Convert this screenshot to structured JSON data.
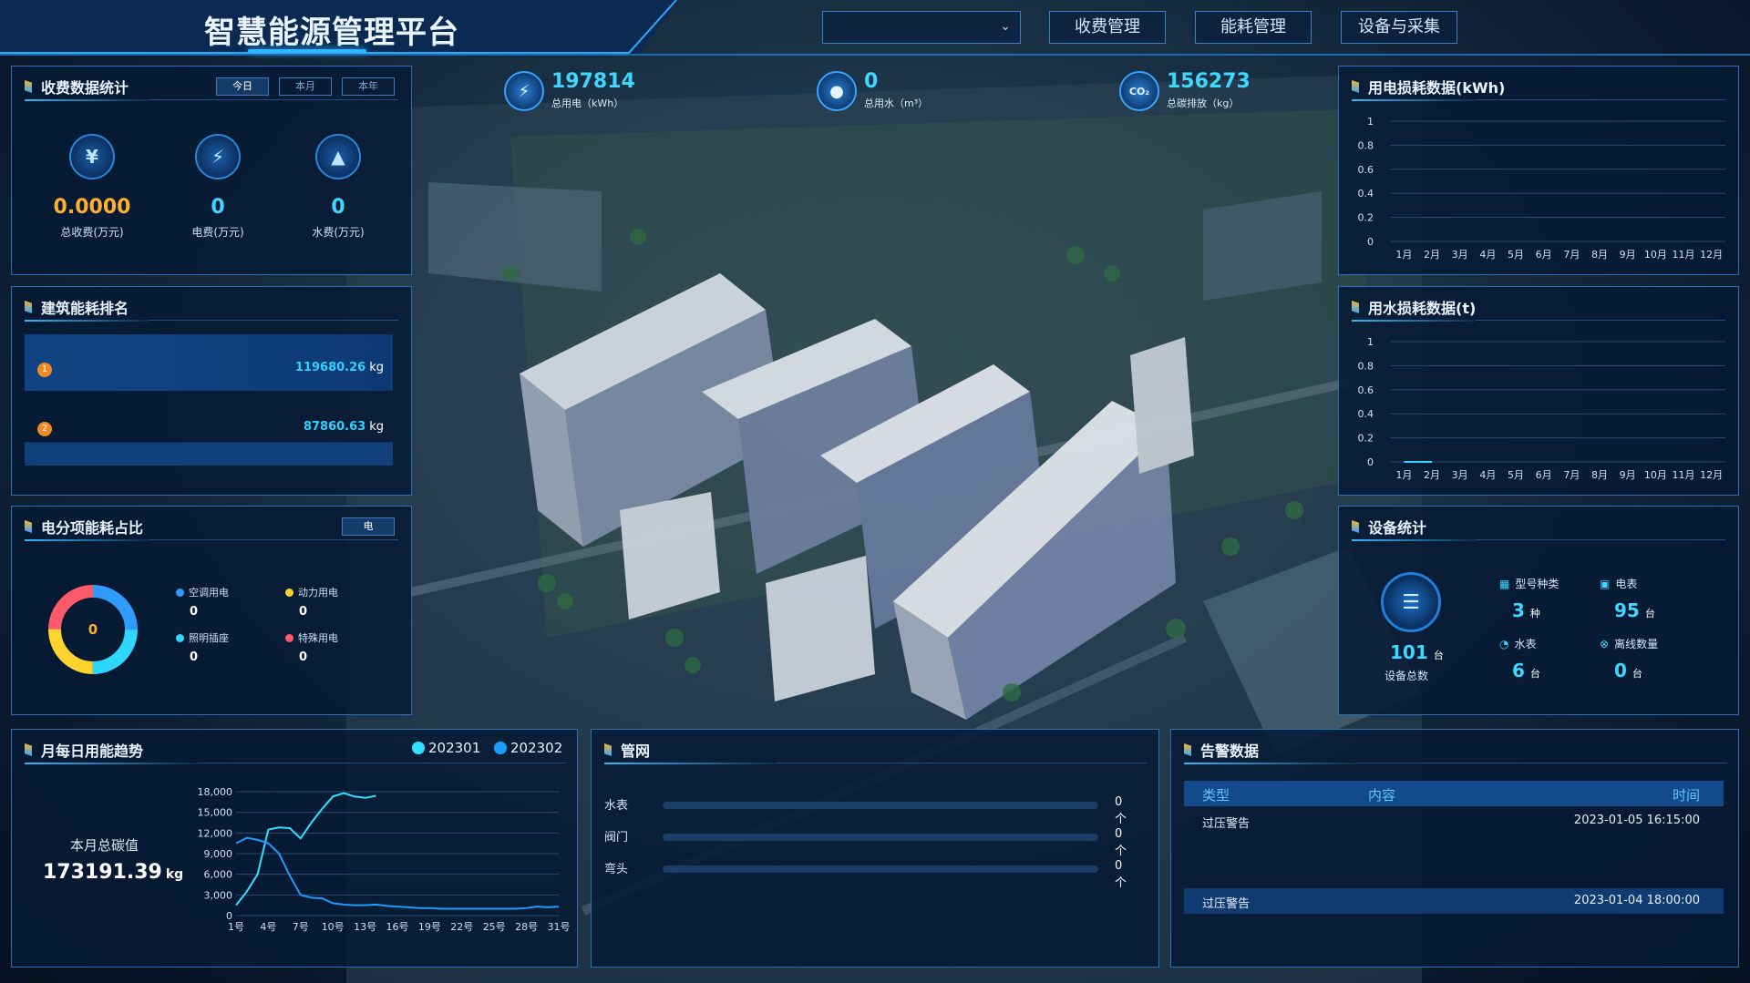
{
  "header": {
    "title": "智慧能源管理平台",
    "select_value": "",
    "nav": [
      "收费管理",
      "能耗管理",
      "设备与采集"
    ]
  },
  "kpis": [
    {
      "icon": "lightning-icon",
      "value": "197814",
      "label": "总用电（kWh）"
    },
    {
      "icon": "water-drop-icon",
      "value": "0",
      "label": "总用水（m³）"
    },
    {
      "icon": "co2-cloud-icon",
      "value": "156273",
      "label": "总碳排放（kg）"
    }
  ],
  "fee_panel": {
    "title": "收费数据统计",
    "tabs": [
      "今日",
      "本月",
      "本年"
    ],
    "active_tab": "今日",
    "items": [
      {
        "icon": "yuan-icon",
        "glyph": "¥",
        "value": "0.0000",
        "label": "总收费(万元)",
        "color": "#ffb02e"
      },
      {
        "icon": "electric-fee-icon",
        "glyph": "⚡",
        "value": "0",
        "label": "电费(万元)",
        "color": "#3fd6ff"
      },
      {
        "icon": "water-fee-icon",
        "glyph": "💧",
        "value": "0",
        "label": "水费(万元)",
        "color": "#3fd6ff"
      }
    ]
  },
  "rank_panel": {
    "title": "建筑能耗排名",
    "rows": [
      {
        "rank": "1",
        "value": "119680.26",
        "unit": "kg",
        "fraction": 1.0
      },
      {
        "rank": "2",
        "value": "87860.63",
        "unit": "kg",
        "fraction": 0.73
      }
    ]
  },
  "ratio_panel": {
    "title": "电分项能耗占比",
    "button": "电",
    "center": "0",
    "items": [
      {
        "name": "空调用电",
        "value": "0",
        "color": "#2f9bff"
      },
      {
        "name": "动力用电",
        "value": "0",
        "color": "#ffd32e"
      },
      {
        "name": "照明插座",
        "value": "0",
        "color": "#2fd6ff"
      },
      {
        "name": "特殊用电",
        "value": "0",
        "color": "#ff5a6a"
      }
    ]
  },
  "trend_panel": {
    "title": "月每日用能趋势",
    "summary_label": "本月总碳值",
    "summary_value": "173191.39",
    "summary_unit": "kg"
  },
  "pipe_panel": {
    "title": "管网",
    "rows": [
      {
        "name": "水表",
        "value": "0个"
      },
      {
        "name": "阀门",
        "value": "0个"
      },
      {
        "name": "弯头",
        "value": "0个"
      }
    ]
  },
  "alarm_panel": {
    "title": "告警数据",
    "headers": [
      "类型",
      "内容",
      "时间"
    ],
    "rows": [
      {
        "type": "过压警告",
        "content": "",
        "time": "2023-01-05 16:15:00"
      },
      {
        "type": "过压警告",
        "content": "",
        "time": "2023-01-04 18:00:00"
      }
    ]
  },
  "elec_loss_panel": {
    "title": "用电损耗数据(kWh)"
  },
  "water_loss_panel": {
    "title": "用水损耗数据(t)"
  },
  "device_panel": {
    "title": "设备统计",
    "total_value": "101",
    "total_unit": "台",
    "total_label": "设备总数",
    "items": [
      {
        "icon": "model-type-icon",
        "label": "型号种类",
        "value": "3",
        "unit": "种"
      },
      {
        "icon": "electric-meter-icon",
        "label": "电表",
        "value": "95",
        "unit": "台"
      },
      {
        "icon": "water-meter-icon",
        "label": "水表",
        "value": "6",
        "unit": "台"
      },
      {
        "icon": "offline-icon",
        "label": "离线数量",
        "value": "0",
        "unit": "台"
      }
    ]
  },
  "chart_data": [
    {
      "type": "line",
      "title": "用电损耗数据(kWh)",
      "categories": [
        "1月",
        "2月",
        "3月",
        "4月",
        "5月",
        "6月",
        "7月",
        "8月",
        "9月",
        "10月",
        "11月",
        "12月"
      ],
      "y_ticks": [
        "0",
        "0.2",
        "0.4",
        "0.6",
        "0.8",
        "1"
      ],
      "ylim": [
        0,
        1
      ],
      "series": [
        {
          "values": []
        }
      ],
      "grid": true
    },
    {
      "type": "line",
      "title": "用水损耗数据(t)",
      "categories": [
        "1月",
        "2月",
        "3月",
        "4月",
        "5月",
        "6月",
        "7月",
        "8月",
        "9月",
        "10月",
        "11月",
        "12月"
      ],
      "y_ticks": [
        "0",
        "0.2",
        "0.4",
        "0.6",
        "0.8",
        "1"
      ],
      "ylim": [
        0,
        1
      ],
      "series": [
        {
          "values": [
            0,
            0
          ]
        }
      ],
      "grid": true
    },
    {
      "type": "line",
      "title": "月每日用能趋势",
      "x_ticks": [
        "1号",
        "4号",
        "7号",
        "10号",
        "13号",
        "16号",
        "19号",
        "22号",
        "25号",
        "28号",
        "31号"
      ],
      "y_ticks": [
        "0",
        "3,000",
        "6,000",
        "9,000",
        "12,000",
        "15,000",
        "18,000"
      ],
      "ylim": [
        0,
        18000
      ],
      "xlim": [
        1,
        31
      ],
      "legend_position": "top-right",
      "series": [
        {
          "name": "202301",
          "color": "#2fe0ff",
          "x": [
            1,
            2,
            3,
            4,
            5,
            6,
            7,
            8,
            9,
            10,
            11,
            12,
            13,
            14,
            15,
            16,
            17,
            18,
            19,
            20,
            21,
            22,
            23,
            24,
            25,
            26,
            27,
            28,
            29,
            30,
            31
          ],
          "values": [
            1500,
            3500,
            6000,
            12500,
            12800,
            12700,
            11200,
            13500,
            15500,
            17300,
            17800,
            17300,
            17100,
            17400,
            null,
            null,
            null,
            null,
            null,
            null,
            null,
            null,
            null,
            null,
            null,
            null,
            null,
            null,
            null,
            null,
            null
          ]
        },
        {
          "name": "202302",
          "color": "#1e9bff",
          "x": [
            1,
            2,
            3,
            4,
            5,
            6,
            7,
            8,
            9,
            10,
            11,
            12,
            13,
            14,
            15,
            16,
            17,
            18,
            19,
            20,
            21,
            22,
            23,
            24,
            25,
            26,
            27,
            28,
            29,
            30,
            31
          ],
          "values": [
            10500,
            11300,
            11000,
            10500,
            9000,
            5800,
            3000,
            2600,
            2500,
            1800,
            1600,
            1500,
            1500,
            1600,
            1400,
            1300,
            1200,
            1100,
            1100,
            1000,
            1000,
            1000,
            1000,
            1000,
            1000,
            1000,
            1000,
            1100,
            1300,
            1200,
            1300
          ]
        }
      ]
    }
  ]
}
